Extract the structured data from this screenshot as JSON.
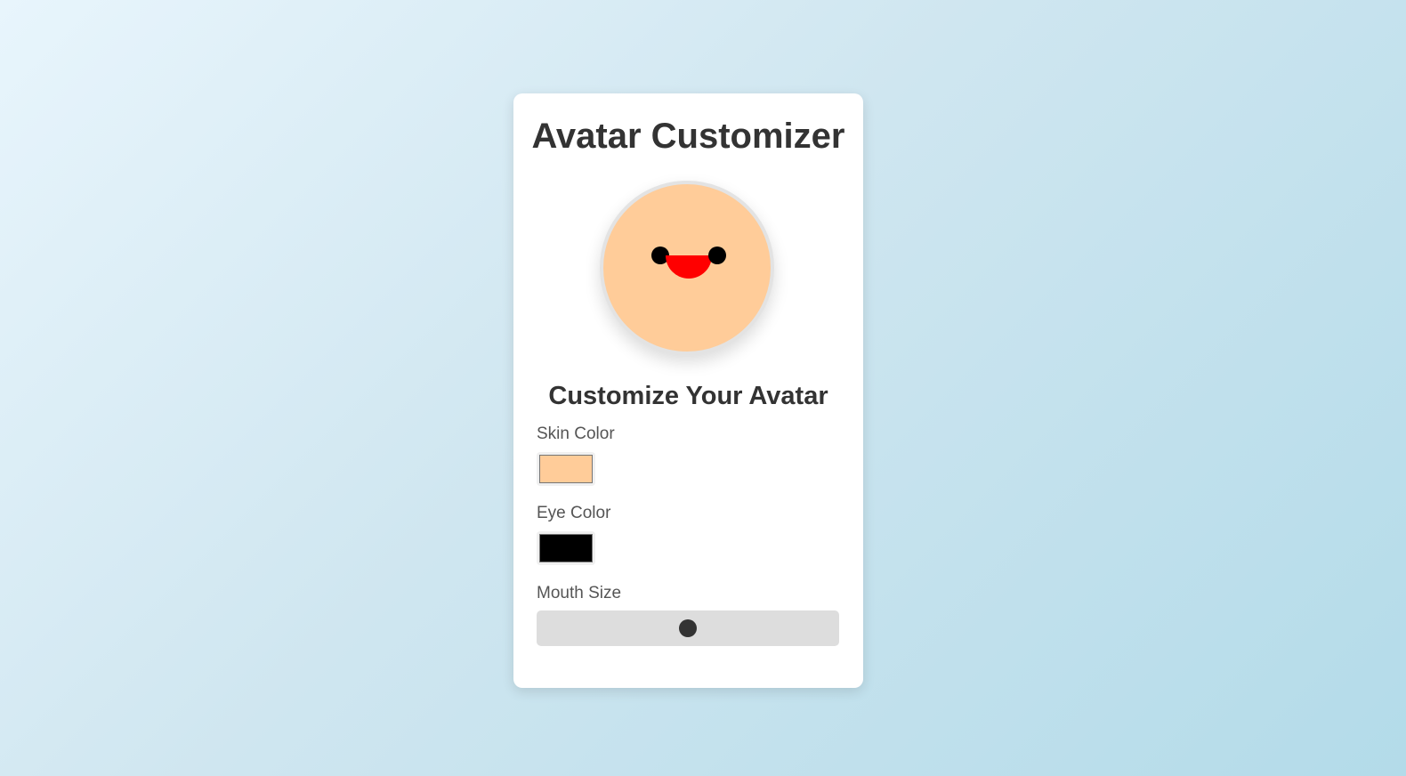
{
  "header": {
    "title": "Avatar Customizer"
  },
  "avatar": {
    "skin_color": "#ffcc99",
    "eye_color": "#000000",
    "mouth_color": "#ff0000"
  },
  "controls": {
    "heading": "Customize Your Avatar",
    "skin_color_label": "Skin Color",
    "skin_color_value": "#ffcc99",
    "eye_color_label": "Eye Color",
    "eye_color_value": "#000000",
    "mouth_size_label": "Mouth Size",
    "mouth_size_fraction": 0.5
  }
}
